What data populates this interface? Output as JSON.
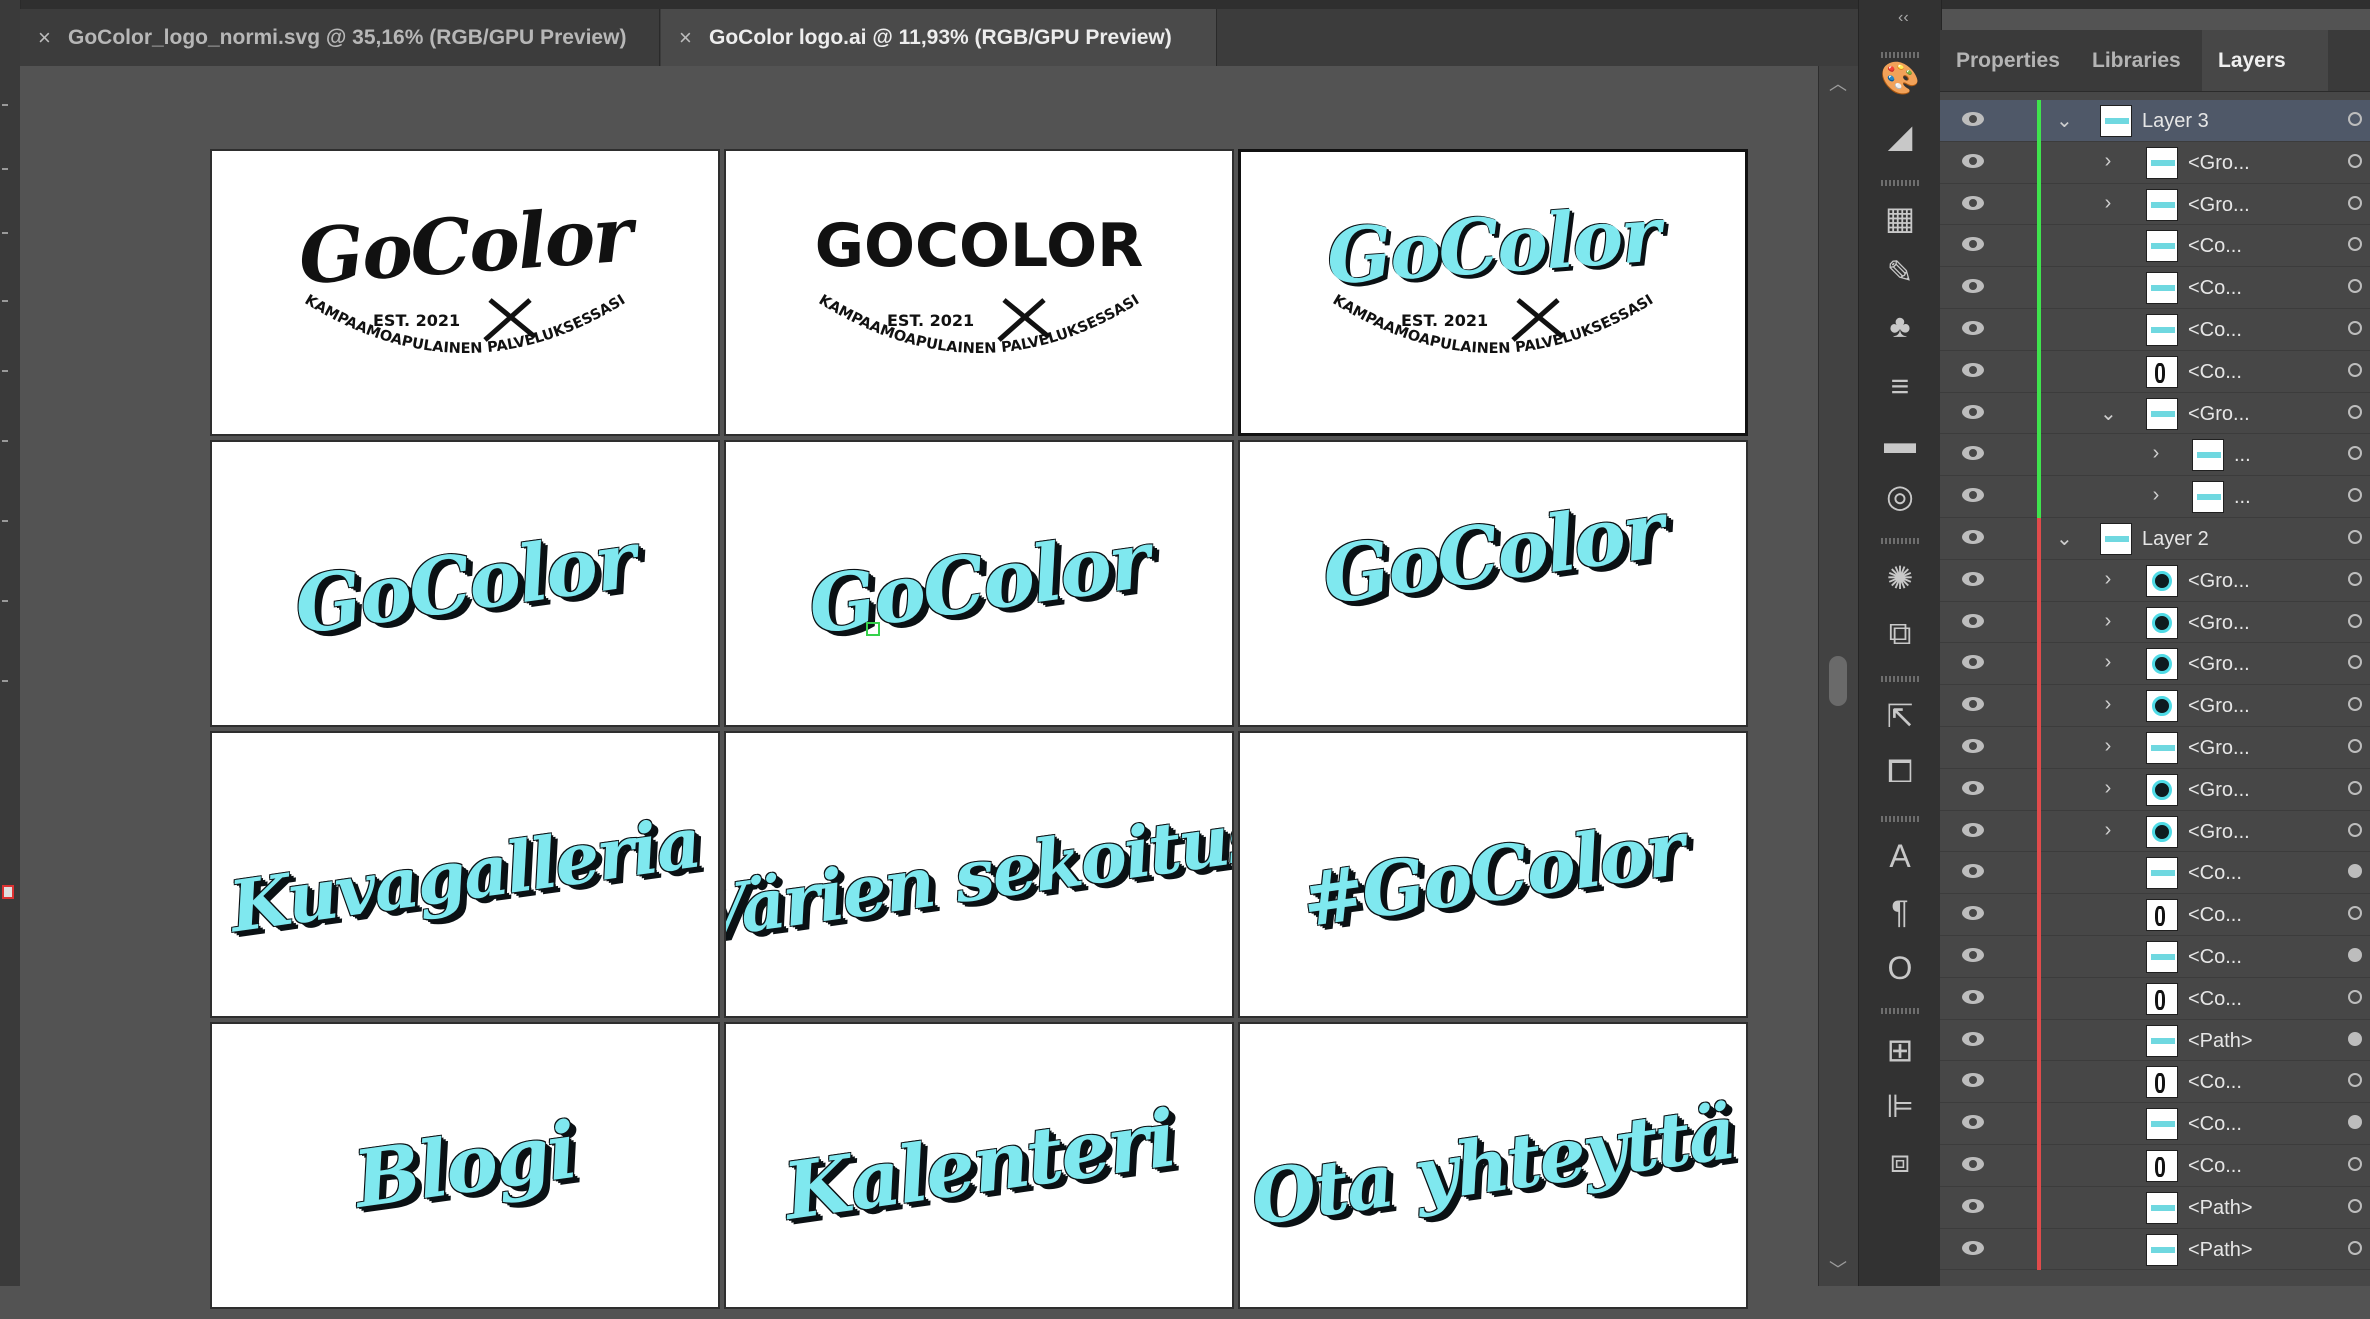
{
  "window": {
    "tabs": [
      {
        "label": "GoColor_logo_normi.svg @ 35,16% (RGB/GPU Preview)",
        "active": false,
        "close": "×"
      },
      {
        "label": "GoColor logo.ai @ 11,93% (RGB/GPU Preview)",
        "active": true,
        "close": "×"
      }
    ],
    "collapse_glyph": "‹‹"
  },
  "canvas": {
    "artboards": [
      {
        "kind": "logo",
        "title": "GoColor",
        "est": "EST. 2021",
        "arc": "KAMPAAMOAPULAINEN PALVELUKSESSASI",
        "style": "script-black"
      },
      {
        "kind": "logo",
        "title": "GOCOLOR",
        "est": "EST. 2021",
        "arc": "KAMPAAMOAPULAINEN PALVELUKSESSASI",
        "style": "caps-black"
      },
      {
        "kind": "logo",
        "title": "GoColor",
        "est": "EST. 2021",
        "arc": "KAMPAAMOAPULAINEN PALVELUKSESSASI",
        "style": "script-cyan",
        "selected": true
      },
      {
        "kind": "word",
        "text": "GoColor"
      },
      {
        "kind": "word",
        "text": "GoColor"
      },
      {
        "kind": "word",
        "text": "GoColor"
      },
      {
        "kind": "word",
        "text": "Kuvagalleria"
      },
      {
        "kind": "word",
        "text": "Värien sekoitus"
      },
      {
        "kind": "word",
        "text": "#GoColor"
      },
      {
        "kind": "word",
        "text": "Blogi"
      },
      {
        "kind": "word",
        "text": "Kalenteri"
      },
      {
        "kind": "word",
        "text": "Ota yhteyttä"
      }
    ]
  },
  "panel": {
    "tabs": [
      "Properties",
      "Libraries",
      "Layers"
    ],
    "active_tab": "Layers",
    "colors": {
      "layer3": "#3fe34d",
      "layer2": "#e14b4b",
      "highlight": "#4f5868"
    }
  },
  "layers": [
    {
      "name": "Layer 3",
      "depth": 0,
      "expander": "open",
      "thumb": "t",
      "color": "g",
      "highlight": true
    },
    {
      "name": "<Gro...",
      "depth": 1,
      "expander": "closed",
      "thumb": "t",
      "color": "g"
    },
    {
      "name": "<Gro...",
      "depth": 1,
      "expander": "closed",
      "thumb": "t",
      "color": "g"
    },
    {
      "name": "<Co...",
      "depth": 1,
      "expander": "none",
      "thumb": "t",
      "color": "g"
    },
    {
      "name": "<Co...",
      "depth": 1,
      "expander": "none",
      "thumb": "t",
      "color": "g"
    },
    {
      "name": "<Co...",
      "depth": 1,
      "expander": "none",
      "thumb": "t",
      "color": "g"
    },
    {
      "name": "<Co...",
      "depth": 1,
      "expander": "none",
      "thumb": "k",
      "color": "g"
    },
    {
      "name": "<Gro...",
      "depth": 1,
      "expander": "open",
      "thumb": "t",
      "color": "g"
    },
    {
      "name": "...",
      "depth": 2,
      "expander": "closed",
      "thumb": "t",
      "color": "g"
    },
    {
      "name": "...",
      "depth": 2,
      "expander": "closed",
      "thumb": "t",
      "color": "g"
    },
    {
      "name": "Layer 2",
      "depth": 0,
      "expander": "open",
      "thumb": "t",
      "color": "r"
    },
    {
      "name": "<Gro...",
      "depth": 1,
      "expander": "closed",
      "thumb": "c",
      "color": "r"
    },
    {
      "name": "<Gro...",
      "depth": 1,
      "expander": "closed",
      "thumb": "c",
      "color": "r"
    },
    {
      "name": "<Gro...",
      "depth": 1,
      "expander": "closed",
      "thumb": "c",
      "color": "r"
    },
    {
      "name": "<Gro...",
      "depth": 1,
      "expander": "closed",
      "thumb": "c",
      "color": "r"
    },
    {
      "name": "<Gro...",
      "depth": 1,
      "expander": "closed",
      "thumb": "t",
      "color": "r"
    },
    {
      "name": "<Gro...",
      "depth": 1,
      "expander": "closed",
      "thumb": "c",
      "color": "r"
    },
    {
      "name": "<Gro...",
      "depth": 1,
      "expander": "closed",
      "thumb": "c",
      "color": "r"
    },
    {
      "name": "<Co...",
      "depth": 1,
      "expander": "none",
      "thumb": "t",
      "color": "r",
      "filled": true
    },
    {
      "name": "<Co...",
      "depth": 1,
      "expander": "none",
      "thumb": "k",
      "color": "r"
    },
    {
      "name": "<Co...",
      "depth": 1,
      "expander": "none",
      "thumb": "t",
      "color": "r",
      "filled": true
    },
    {
      "name": "<Co...",
      "depth": 1,
      "expander": "none",
      "thumb": "k",
      "color": "r"
    },
    {
      "name": "<Path>",
      "depth": 1,
      "expander": "none",
      "thumb": "t",
      "color": "r",
      "filled": true
    },
    {
      "name": "<Co...",
      "depth": 1,
      "expander": "none",
      "thumb": "k",
      "color": "r"
    },
    {
      "name": "<Co...",
      "depth": 1,
      "expander": "none",
      "thumb": "t",
      "color": "r",
      "filled": true
    },
    {
      "name": "<Co...",
      "depth": 1,
      "expander": "none",
      "thumb": "k",
      "color": "r"
    },
    {
      "name": "<Path>",
      "depth": 1,
      "expander": "none",
      "thumb": "t",
      "color": "r"
    },
    {
      "name": "<Path>",
      "depth": 1,
      "expander": "none",
      "thumb": "t",
      "color": "r"
    }
  ],
  "toolstrip_icons": [
    "palette-icon",
    "gradient-tool-icon",
    "swatches-icon",
    "brushes-icon",
    "symbols-icon",
    "stroke-icon",
    "gradient-icon",
    "transparency-icon",
    "appearance-icon",
    "graphic-styles-icon",
    "export-icon",
    "asset-export-icon",
    "character-icon",
    "paragraph-icon",
    "opentype-icon",
    "transform-icon",
    "align-icon",
    "pathfinder-icon"
  ]
}
